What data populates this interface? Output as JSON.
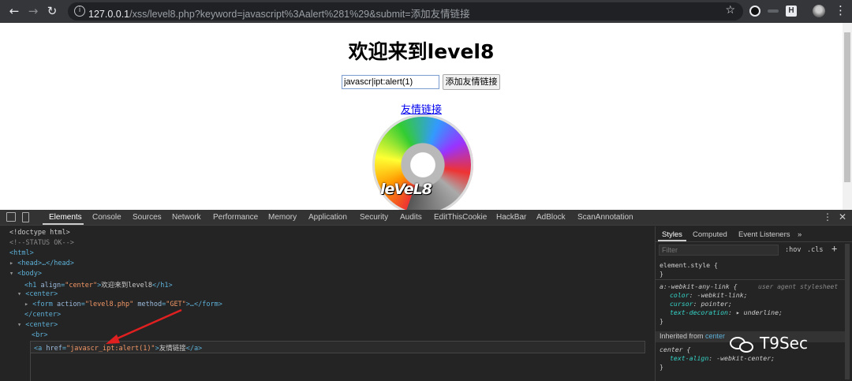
{
  "browser": {
    "url_host": "127.0.0.1",
    "url_rest": "/xss/level8.php?keyword=javascript%3Aalert%281%29&submit=添加友情链接",
    "back_icon": "back-arrow-icon",
    "forward_icon": "forward-arrow-icon",
    "reload_icon": "reload-icon"
  },
  "page": {
    "heading": "欢迎来到level8",
    "keyword_value": "javascr|ipt:alert(1)",
    "submit_label": "添加友情链接",
    "friend_link": "友情链接",
    "image_label": "leVeL8"
  },
  "devtools": {
    "tabs": [
      "Elements",
      "Console",
      "Sources",
      "Network",
      "Performance",
      "Memory",
      "Application",
      "Security",
      "Audits",
      "EditThisCookie",
      "HackBar",
      "AdBlock",
      "ScanAnnotation"
    ],
    "dom": {
      "doctype": "<!doctype html>",
      "status_comment": "<!--STATUS OK-->",
      "html_open": "<html>",
      "head": "<head>…</head>",
      "body_open": "<body>",
      "h1_tag_open": "<h1 ",
      "h1_attr": "align",
      "h1_attr_val": "\"center\"",
      "h1_text": "欢迎来到level8",
      "h1_close": "</h1>",
      "center_open": "<center>",
      "form_open": "<form ",
      "form_action": "action",
      "form_action_val": "\"level8.php\"",
      "form_method": "method",
      "form_method_val": "\"GET\"",
      "form_rest": "…</form>",
      "center_close": "</center>",
      "br": "<br>",
      "a_open": "<a ",
      "a_href": "href",
      "a_href_val": "\"javascr_ipt:alert(1)\"",
      "a_text": "友情链接",
      "a_close": "</a>"
    },
    "styles": {
      "tabs": [
        "Styles",
        "Computed",
        "Event Listeners"
      ],
      "filter_placeholder": "Filter",
      "hov": ":hov",
      "cls": ".cls",
      "element_style": "element.style {",
      "close_brace": "}",
      "rule_selector": "a:-webkit-any-link {",
      "ua_label": "user agent stylesheet",
      "props": [
        {
          "name": "color",
          "value": "-webkit-link;"
        },
        {
          "name": "cursor",
          "value": "pointer;"
        },
        {
          "name": "text-decoration",
          "value": "▸ underline;"
        }
      ],
      "inherited_prefix": "Inherited from ",
      "inherited_tag": "center",
      "center_selector": "center {",
      "center_prop": {
        "name": "text-align",
        "value": "-webkit-center;"
      }
    },
    "watermark": "T9Sec"
  }
}
